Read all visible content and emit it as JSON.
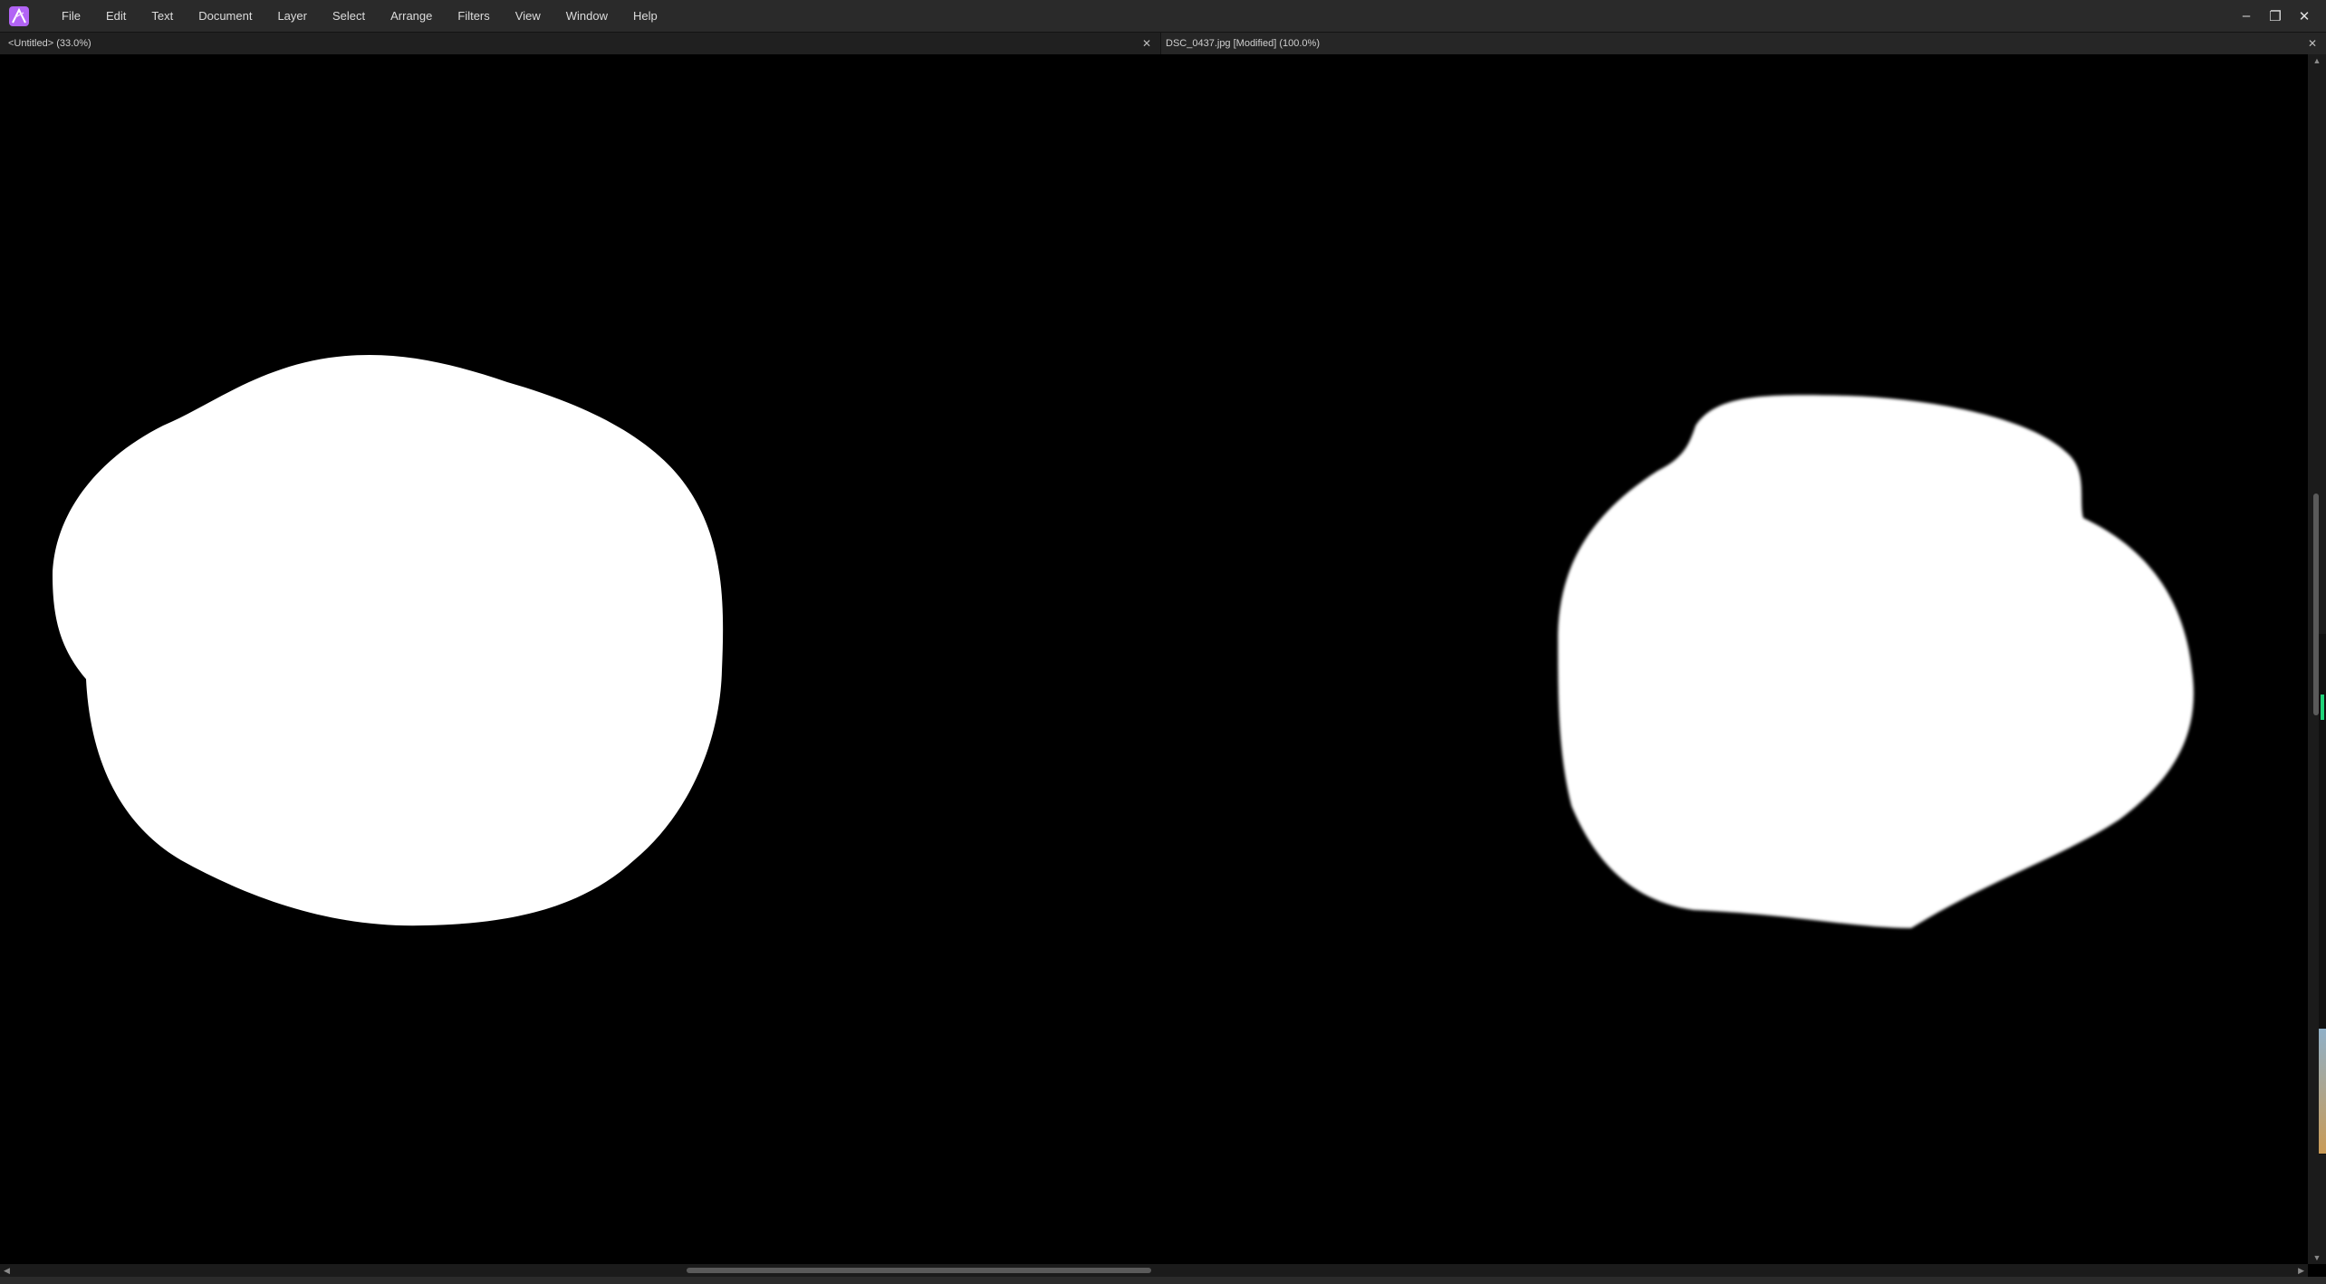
{
  "app": {
    "logo_icon": "affinity-photo-logo-icon",
    "accent_color": "#b264f5"
  },
  "menu": {
    "items": [
      "File",
      "Edit",
      "Text",
      "Document",
      "Layer",
      "Select",
      "Arrange",
      "Filters",
      "View",
      "Window",
      "Help"
    ]
  },
  "window_controls": {
    "minimize_icon": "minimize-icon",
    "restore_icon": "restore-icon",
    "close_icon": "close-icon",
    "minimize": "–",
    "restore": "❐",
    "close": "✕"
  },
  "tabs": [
    {
      "title": "<Untitled> (33.0%)",
      "close": "✕"
    },
    {
      "title": "DSC_0437.jpg [Modified] (100.0%)",
      "close": "✕"
    }
  ],
  "canvas": {
    "background_color": "#000000",
    "shape_color": "#ffffff"
  },
  "scrollbars": {
    "up_arrow": "▲",
    "down_arrow": "▼",
    "left_arrow": "◀",
    "right_arrow": "▶"
  }
}
